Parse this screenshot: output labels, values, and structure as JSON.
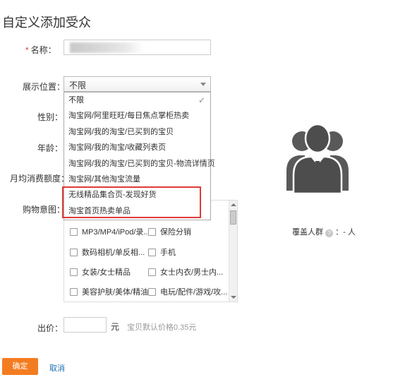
{
  "page": {
    "title": "自定义添加受众"
  },
  "form": {
    "name_label": "名称：",
    "name_required": "*",
    "name_value": "",
    "position_label": "展示位置：",
    "position_selected": "不限",
    "gender_label": "性别：",
    "age_label": "年龄：",
    "monthly_spend_label": "月均消费额度：",
    "shopping_intent_label": "购物意图：",
    "bid_label": "出价：",
    "bid_value": "",
    "bid_unit": "元",
    "bid_hint": "宝贝默认价格0.35元"
  },
  "dropdown": {
    "items": [
      {
        "label": "不限",
        "selected": true
      },
      {
        "label": "淘宝网/阿里旺旺/每日焦点掌柜热卖"
      },
      {
        "label": "淘宝网/我的淘宝/已买到的宝贝"
      },
      {
        "label": "淘宝网/我的淘宝/收藏列表页"
      },
      {
        "label": "淘宝网/我的淘宝/已买到的宝贝-物流详情页"
      },
      {
        "label": "淘宝网/其他淘宝流量"
      },
      {
        "label": "无线精品集合页-发现好货"
      },
      {
        "label": "淘宝首页热卖单品"
      }
    ],
    "check_glyph": "✓",
    "highlight_color": "#e03a3a"
  },
  "intent_list": {
    "items": [
      "MP3/MP4/iPod/录...",
      "保险分销",
      "数码相机/单反相...",
      "手机",
      "女装/女士精品",
      "女士内衣/男士内...",
      "美容护肤/美体/精油",
      "电玩/配件/游戏/攻..."
    ]
  },
  "coverage": {
    "label": "覆盖人群",
    "help_icon": "question-icon",
    "value": "：- 人"
  },
  "buttons": {
    "confirm": "确定",
    "cancel": "取消"
  },
  "colors": {
    "accent": "#f47c20",
    "link": "#1f6fb2",
    "required": "#e4393c",
    "avatar": "#595959"
  }
}
